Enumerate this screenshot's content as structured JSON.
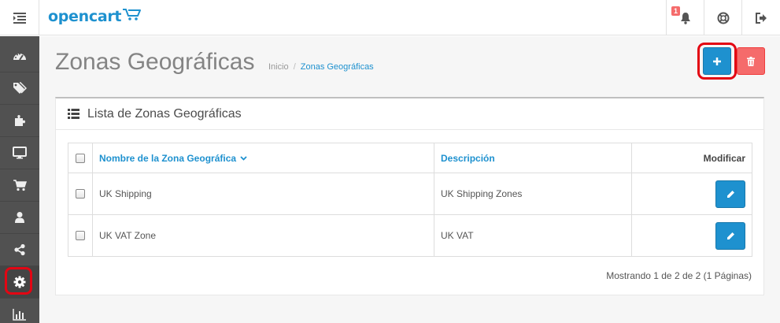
{
  "header": {
    "logo_text": "opencart",
    "notification_count": "1",
    "icons": [
      "menu-icon",
      "cart-icon",
      "bell-icon",
      "life-ring-icon",
      "sign-out-icon"
    ]
  },
  "sidebar": {
    "items": [
      {
        "icon": "dashboard-icon"
      },
      {
        "icon": "tags-icon"
      },
      {
        "icon": "puzzle-icon"
      },
      {
        "icon": "desktop-icon"
      },
      {
        "icon": "shopping-cart-icon"
      },
      {
        "icon": "user-icon"
      },
      {
        "icon": "share-icon"
      },
      {
        "icon": "cog-icon"
      },
      {
        "icon": "bar-chart-icon"
      }
    ]
  },
  "page": {
    "title": "Zonas Geográficas",
    "breadcrumb": {
      "home": "Inicio",
      "separator": "/",
      "current": "Zonas Geográficas"
    }
  },
  "actions": {
    "add_icon": "plus-icon",
    "delete_icon": "trash-icon"
  },
  "panel": {
    "title": "Lista de Zonas Geográficas",
    "columns": {
      "name": "Nombre de la Zona Geográfica",
      "description": "Descripción",
      "action": "Modificar"
    },
    "rows": [
      {
        "name": "UK Shipping",
        "description": "UK Shipping Zones"
      },
      {
        "name": "UK VAT Zone",
        "description": "UK VAT"
      }
    ],
    "pagination": "Mostrando 1 de 2 de 2 (1 Páginas)"
  },
  "colors": {
    "primary": "#1e91cf",
    "danger": "#f56b6b",
    "sidebar": "#515151",
    "highlight": "#e30613"
  }
}
